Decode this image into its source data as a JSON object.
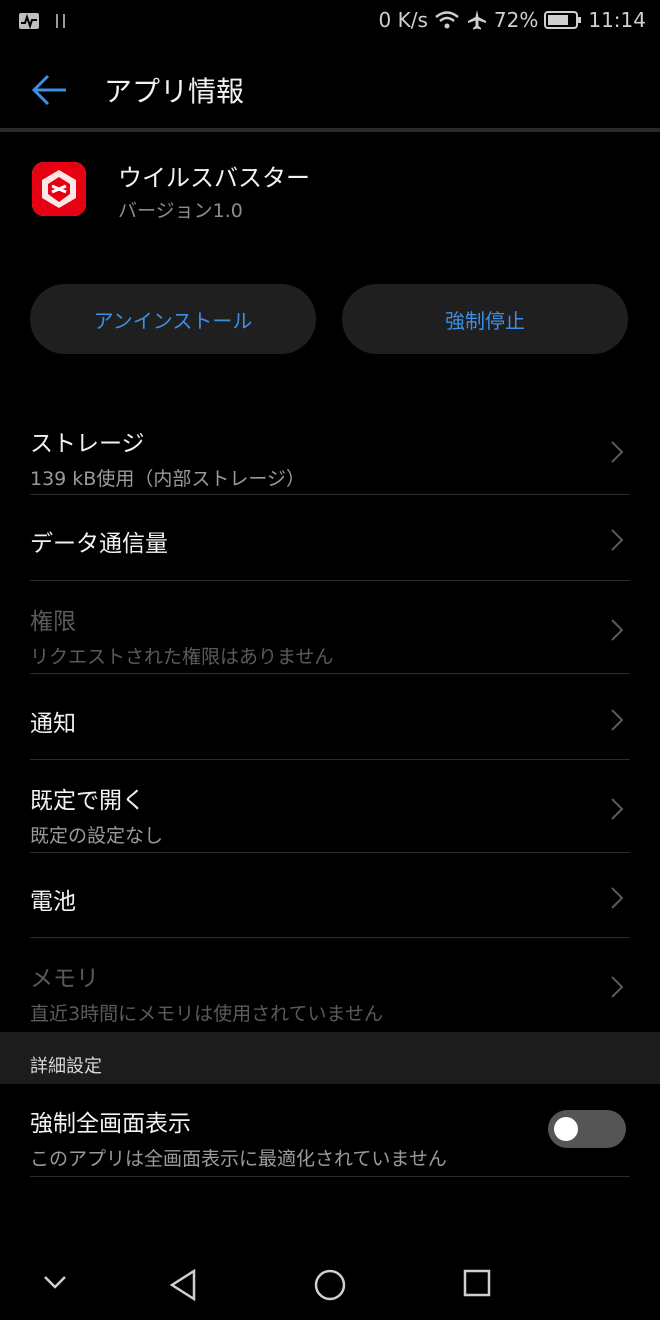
{
  "status": {
    "speed": "0 K/s",
    "battery": "72%",
    "time": "11:14"
  },
  "appbar": {
    "title": "アプリ情報"
  },
  "app": {
    "name": "ウイルスバスター",
    "version": "バージョン1.0"
  },
  "buttons": {
    "uninstall": "アンインストール",
    "force_stop": "強制停止"
  },
  "items": [
    {
      "title": "ストレージ",
      "subtitle": "139 kB使用（内部ストレージ）"
    },
    {
      "title": "データ通信量"
    },
    {
      "title": "権限",
      "subtitle": "リクエストされた権限はありません"
    },
    {
      "title": "通知"
    },
    {
      "title": "既定で開く",
      "subtitle": "既定の設定なし"
    },
    {
      "title": "電池"
    },
    {
      "title": "メモリ",
      "subtitle": "直近3時間にメモリは使用されていません"
    }
  ],
  "section": {
    "label": "詳細設定"
  },
  "fullscreen": {
    "title": "強制全画面表示",
    "subtitle": "このアプリは全画面表示に最適化されていません",
    "enabled": false
  },
  "colors": {
    "accent": "#3d8fe6",
    "background": "#000000"
  }
}
